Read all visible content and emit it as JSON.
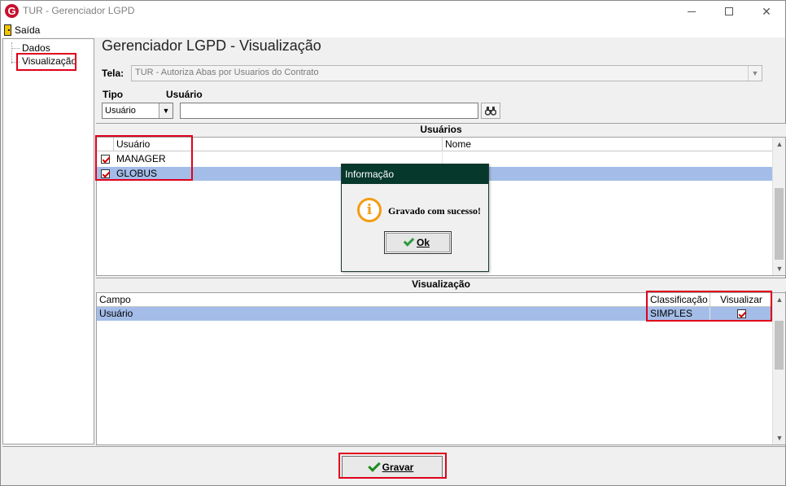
{
  "window": {
    "title": "TUR - Gerenciador LGPD",
    "app_icon_letter": "G"
  },
  "menu": {
    "saida_label": "Saída"
  },
  "tree": {
    "items": [
      {
        "label": "Dados"
      },
      {
        "label": "Visualização"
      }
    ]
  },
  "page": {
    "title": "Gerenciador LGPD - Visualização"
  },
  "tela": {
    "label": "Tela:",
    "value": "TUR - Autoriza Abas por Usuarios do Contrato"
  },
  "filters": {
    "tipo_label": "Tipo",
    "tipo_value": "Usuário",
    "usuario_label": "Usuário",
    "usuario_value": ""
  },
  "usuarios": {
    "header": "Usuários",
    "columns": [
      "Usuário",
      "Nome"
    ],
    "rows": [
      {
        "checked": true,
        "usuario": "MANAGER",
        "nome": ""
      },
      {
        "checked": true,
        "usuario": "GLOBUS",
        "nome": ""
      }
    ]
  },
  "visualizacao": {
    "header": "Visualização",
    "columns": [
      "Campo",
      "Classificação",
      "Visualizar"
    ],
    "rows": [
      {
        "campo": "Usuário",
        "classificacao": "SIMPLES",
        "visualizar": true
      }
    ]
  },
  "footer": {
    "gravar_label": "Gravar"
  },
  "dialog": {
    "title": "Informação",
    "message": "Gravado com sucesso!",
    "ok_label": "Ok"
  },
  "colors": {
    "accent_red": "#e0001b",
    "selected_row": "#a4bde8",
    "dialog_title_bg": "#06382b",
    "info_orange": "#f39c12"
  }
}
